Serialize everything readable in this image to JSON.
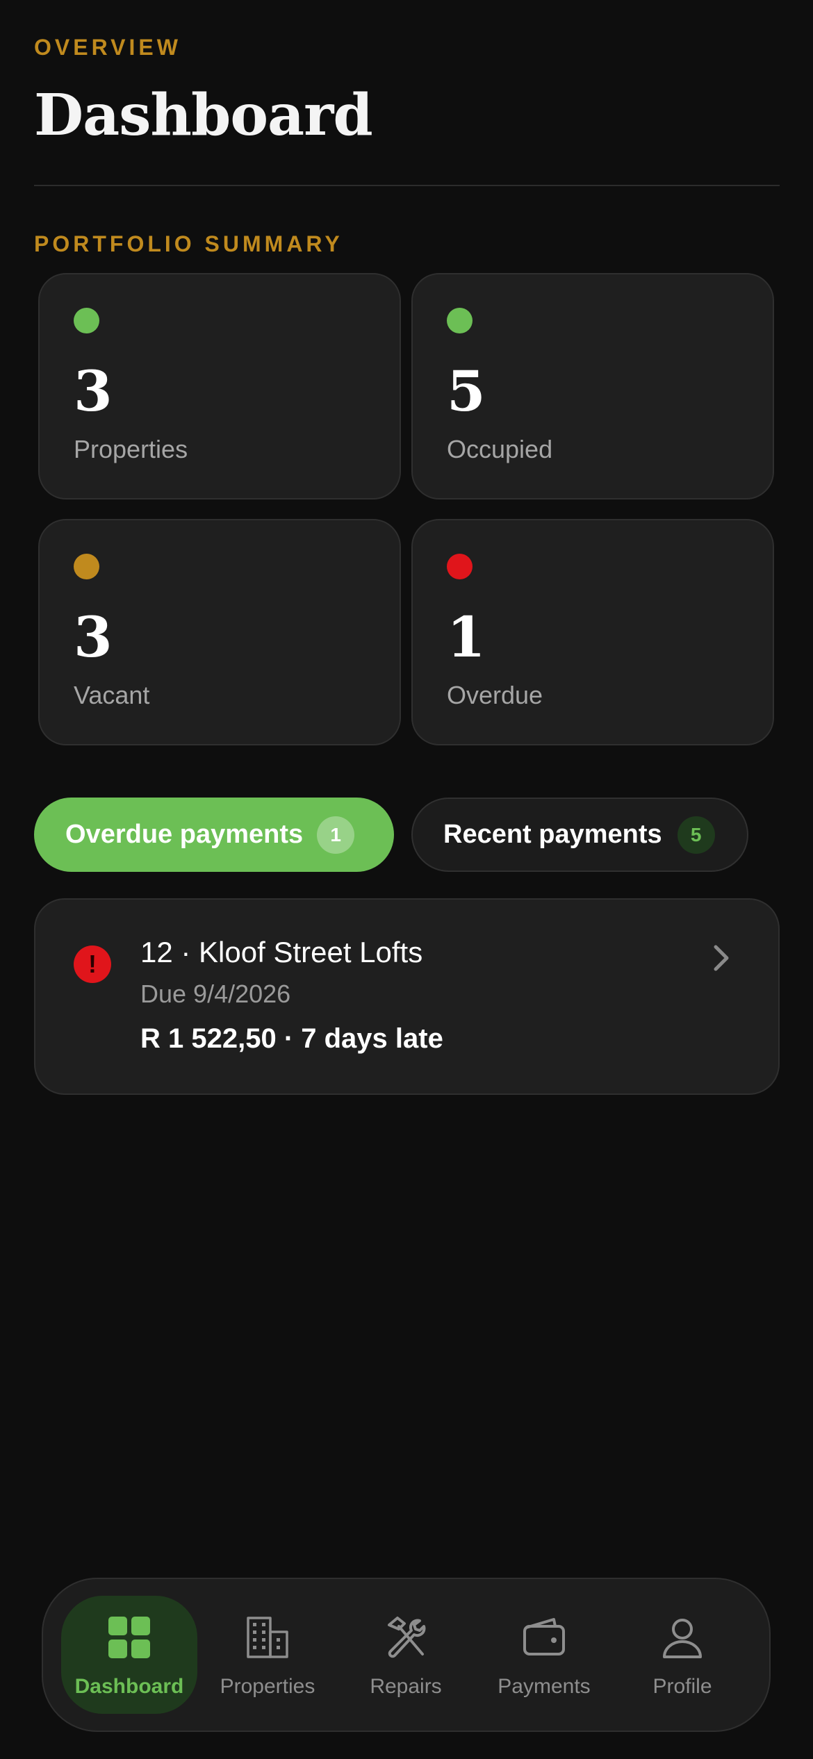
{
  "header": {
    "eyebrow": "OVERVIEW",
    "title": "Dashboard"
  },
  "summary": {
    "label": "PORTFOLIO SUMMARY",
    "cards": [
      {
        "value": "3",
        "label": "Properties",
        "dot_color": "#6cbf55"
      },
      {
        "value": "5",
        "label": "Occupied",
        "dot_color": "#6cbf55"
      },
      {
        "value": "3",
        "label": "Vacant",
        "dot_color": "#c08a1e"
      },
      {
        "value": "1",
        "label": "Overdue",
        "dot_color": "#e0151b"
      }
    ]
  },
  "tabs": [
    {
      "label": "Overdue payments",
      "count": "1",
      "active": true
    },
    {
      "label": "Recent payments",
      "count": "5",
      "active": false
    }
  ],
  "overdue_list": [
    {
      "title": "12 · Kloof Street Lofts",
      "due": "Due 9/4/2026",
      "amount_line": "R 1 522,50 · 7 days late",
      "icon": "alert-icon",
      "icon_glyph": "!"
    }
  ],
  "nav": {
    "items": [
      {
        "label": "Dashboard",
        "icon": "grid-icon",
        "active": true
      },
      {
        "label": "Properties",
        "icon": "building-icon",
        "active": false
      },
      {
        "label": "Repairs",
        "icon": "tools-icon",
        "active": false
      },
      {
        "label": "Payments",
        "icon": "wallet-icon",
        "active": false
      },
      {
        "label": "Profile",
        "icon": "user-icon",
        "active": false
      }
    ]
  },
  "colors": {
    "accent_green": "#6cbf55",
    "accent_gold": "#c08a1e",
    "alert_red": "#e0151b",
    "background": "#0e0e0e",
    "card": "#1f1f1f"
  }
}
